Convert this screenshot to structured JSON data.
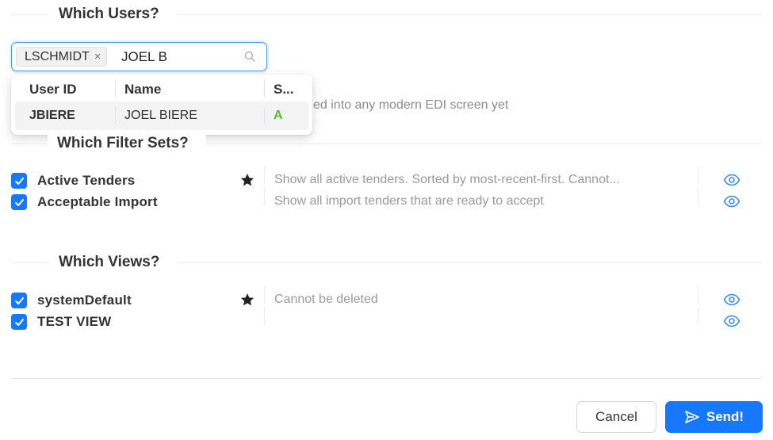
{
  "sections": {
    "users_title": "Which Users?",
    "filters_title": "Which Filter Sets?",
    "views_title": "Which Views?"
  },
  "user_select": {
    "selected_tag": "LSCHMIDT",
    "tag_close": "×",
    "search_value": "JOEL B",
    "icon": "search-icon"
  },
  "dropdown": {
    "columns": [
      "User ID",
      "Name",
      "S..."
    ],
    "rows": [
      {
        "user_id": "JBIERE",
        "name": "JOEL BIERE",
        "status": "A"
      }
    ]
  },
  "help_text": "ed into any modern EDI screen yet",
  "filter_sets": [
    {
      "label": "Active Tenders",
      "checked": true,
      "starred": true,
      "description": "Show all active tenders. Sorted by most-recent-first. Cannot..."
    },
    {
      "label": "Acceptable Import",
      "checked": true,
      "starred": false,
      "description": "Show all import tenders that are ready to accept"
    }
  ],
  "views": [
    {
      "label": "systemDefault",
      "checked": true,
      "starred": true,
      "description": "Cannot be deleted"
    },
    {
      "label": "TEST VIEW",
      "checked": true,
      "starred": false,
      "description": ""
    }
  ],
  "footer": {
    "cancel_label": "Cancel",
    "send_label": "Send!"
  },
  "colors": {
    "accent": "#1677ff",
    "status_active": "#52c41a"
  }
}
